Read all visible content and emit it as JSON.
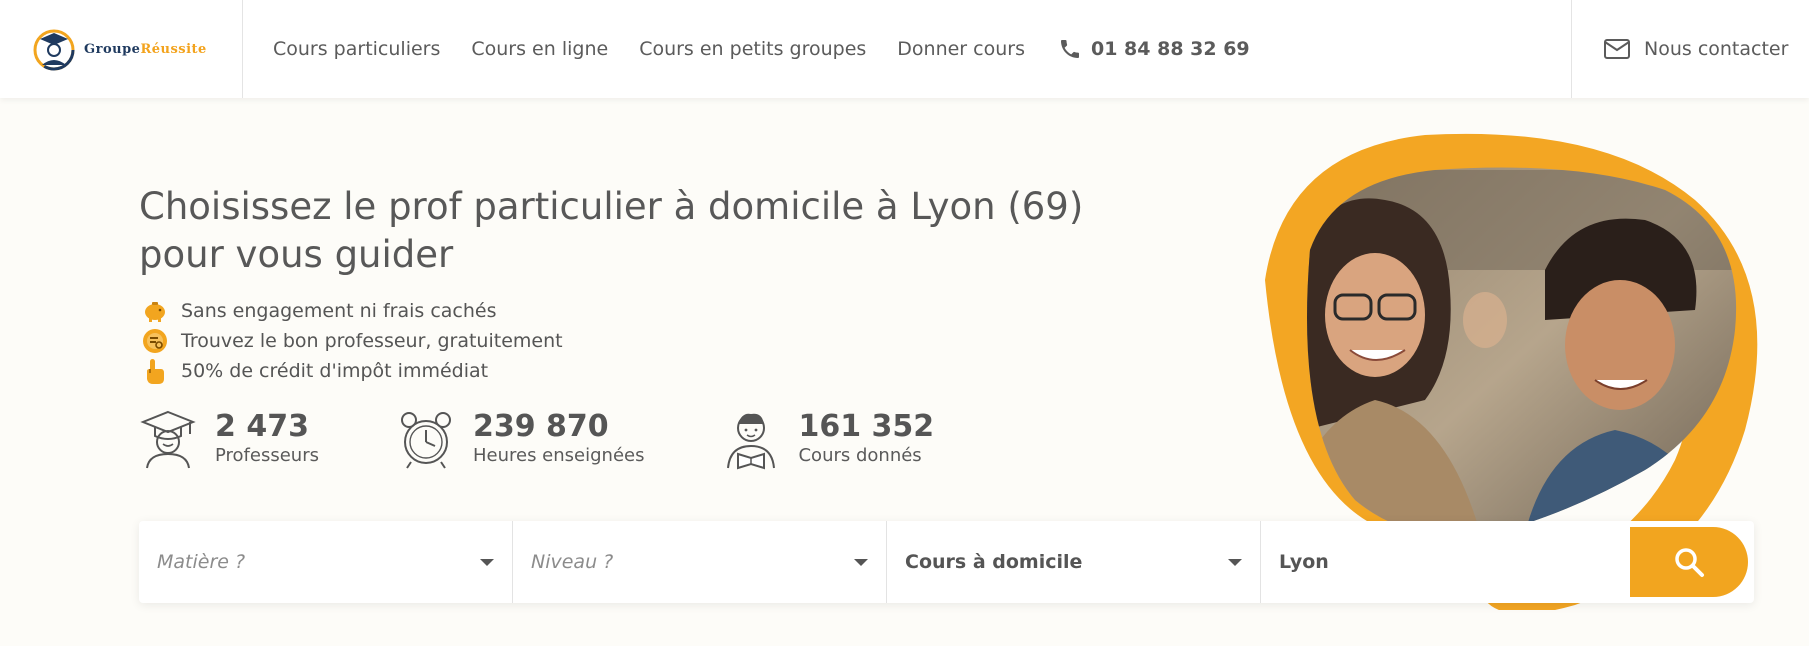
{
  "brand": {
    "part1": "Groupe",
    "part2": "Réussite",
    "accent": "#f2a51f",
    "navy": "#1f3a5f"
  },
  "nav": {
    "items": [
      {
        "label": "Cours particuliers"
      },
      {
        "label": "Cours en ligne"
      },
      {
        "label": "Cours en petits groupes"
      },
      {
        "label": "Donner cours"
      }
    ],
    "phone": "01 84 88 32 69",
    "contact": "Nous contacter"
  },
  "hero": {
    "title": "Choisissez le prof particulier à domicile à Lyon (69) pour vous guider",
    "benefits": [
      {
        "icon": "piggy-bank-icon",
        "text": "Sans engagement ni frais cachés"
      },
      {
        "icon": "search-badge-icon",
        "text": "Trouvez le bon professeur, gratuitement"
      },
      {
        "icon": "pointing-hand-icon",
        "text": "50% de crédit d'impôt immédiat"
      }
    ],
    "stats": [
      {
        "icon": "graduate-icon",
        "number": "2 473",
        "label": "Professeurs"
      },
      {
        "icon": "alarm-clock-icon",
        "number": "239 870",
        "label": "Heures enseignées"
      },
      {
        "icon": "reading-student-icon",
        "number": "161 352",
        "label": "Cours donnés"
      }
    ]
  },
  "search": {
    "subject_placeholder": "Matière ?",
    "level_placeholder": "Niveau ?",
    "mode_value": "Cours à domicile",
    "city_value": "Lyon"
  }
}
